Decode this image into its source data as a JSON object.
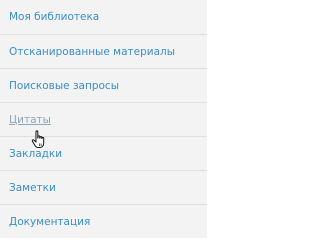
{
  "sidebar": {
    "items": [
      {
        "label": "Моя библиотека"
      },
      {
        "label": "Отсканированные материалы"
      },
      {
        "label": "Поисковые запросы"
      },
      {
        "label": "Цитаты"
      },
      {
        "label": "Закладки"
      },
      {
        "label": "Заметки"
      },
      {
        "label": "Документация"
      }
    ]
  },
  "colors": {
    "link": "#3a8ec7",
    "hover_link": "#8fa7b6",
    "item_bg": "#f3f3f3",
    "divider": "#e0e0e0"
  },
  "cursor": {
    "icon": "hand-pointer-icon"
  }
}
